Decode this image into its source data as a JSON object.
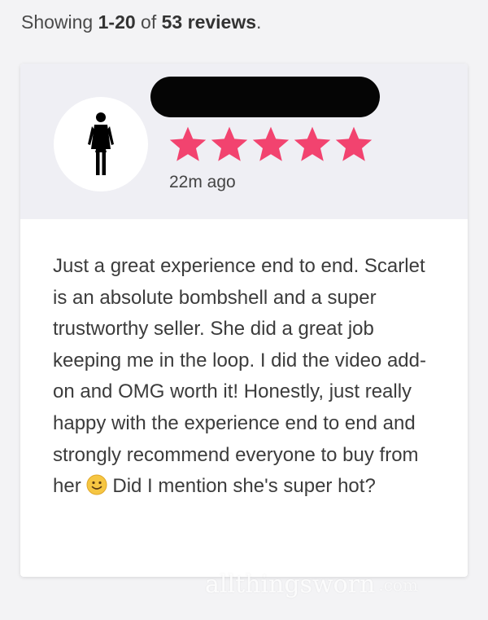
{
  "summary": {
    "prefix": "Showing ",
    "range": "1-20",
    "middle": " of ",
    "count": "53 reviews",
    "suffix": "."
  },
  "review": {
    "rating": 5,
    "max_rating": 5,
    "time_ago": "22m ago",
    "reviewer_avatar_icon": "female-figure-icon",
    "reviewer_name_redacted": true,
    "text": "Just a great experience end to end. Scarlet is an absolute bombshell and a super trustworthy seller. She did a great job keeping me in the loop. I did the video add-on and OMG worth it! Honestly, just really happy with the experience end to end and strongly recommend everyone to buy from her",
    "text_emoji": "smiley-face-icon",
    "text_end": "Did I mention she's super hot?"
  },
  "watermark": {
    "main": "allthingsworn",
    "suffix": ".com"
  },
  "colors": {
    "star": "#f2436f",
    "card_header_bg": "#efeff4",
    "card_bg": "#ffffff",
    "page_bg": "#f3f3f5"
  }
}
